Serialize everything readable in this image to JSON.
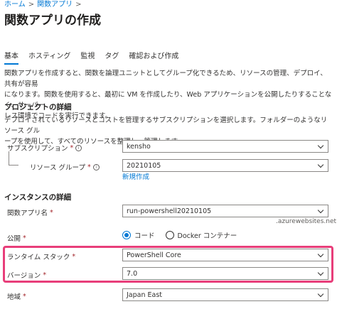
{
  "breadcrumb": {
    "home": "ホーム",
    "sep": ">",
    "current": "関数アプリ",
    "sep2": ">"
  },
  "page_title": "関数アプリの作成",
  "tabs": [
    {
      "label": "基本",
      "active": true
    },
    {
      "label": "ホスティング"
    },
    {
      "label": "監視"
    },
    {
      "label": "タグ"
    },
    {
      "label": "確認および作成"
    }
  ],
  "intro": {
    "line1": "関数アプリを作成すると、関数を論理ユニットとしてグループ化できるため、リソースの管理、デプロイ、共有が容易",
    "line2": "になります。関数を使用すると、最初に VM を作成したり、Web アプリケーションを公開したりすることなく、サーバー",
    "line3": "レス環境でコードを実行できます。"
  },
  "project": {
    "title": "プロジェクトの詳細",
    "line1": "デプロイされているリソースとコストを管理するサブスクリプションを選択します。フォルダーのようなリソース グル",
    "line2": "ープを使用して、すべてのリソースを整理し、管理します。",
    "subscription": {
      "label": "サブスクリプション",
      "req": "*",
      "info": "i",
      "value": "kensho"
    },
    "resource_group": {
      "label": "リソース グループ",
      "req": "*",
      "info": "i",
      "value": "20210105",
      "new_link": "新規作成"
    }
  },
  "instance": {
    "title": "インスタンスの詳細",
    "app_name": {
      "label": "関数アプリ名",
      "req": "*",
      "value": "run-powershell20210105",
      "suffix": ".azurewebsites.net"
    },
    "publish": {
      "label": "公開",
      "req": "*",
      "opt_code": "コード",
      "opt_docker": "Docker コンテナー"
    },
    "runtime": {
      "label": "ランタイム スタック",
      "req": "*",
      "value": "PowerShell Core"
    },
    "version": {
      "label": "バージョン",
      "req": "*",
      "value": "7.0"
    },
    "region": {
      "label": "地域",
      "req": "*",
      "value": "Japan East"
    }
  },
  "colors": {
    "accent": "#0078d4",
    "highlight": "#e83e7a",
    "required": "#a4262c"
  }
}
